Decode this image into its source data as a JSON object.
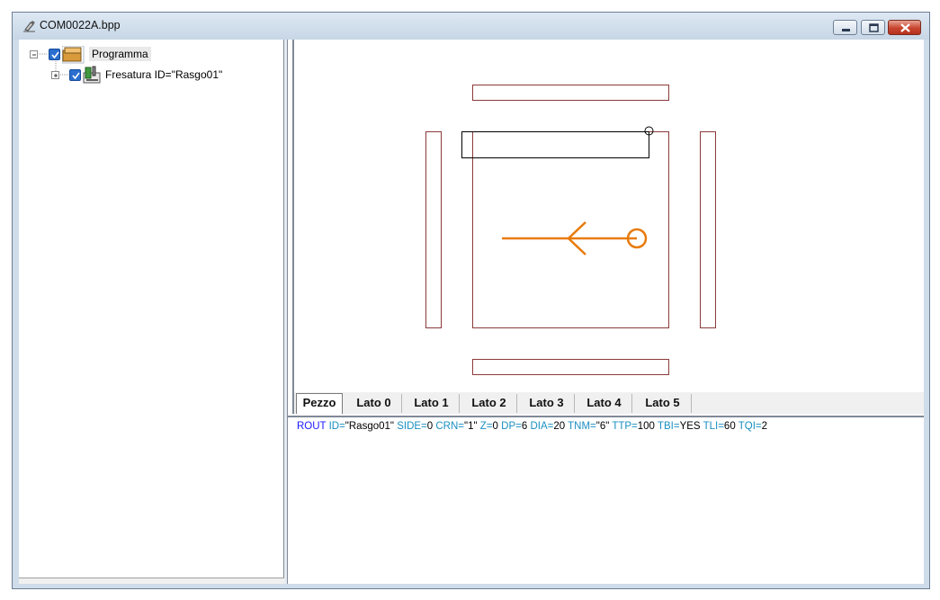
{
  "window": {
    "title": "COM0022A.bpp",
    "icon": "app-document-icon"
  },
  "tree": {
    "root": {
      "label": "Programma",
      "checked": true,
      "expanded": true
    },
    "child": {
      "label": "Fresatura ID=\"Rasgo01\"",
      "checked": true,
      "expanded": false
    }
  },
  "tabs": [
    "Pezzo",
    "Lato 0",
    "Lato 1",
    "Lato 2",
    "Lato 3",
    "Lato 4",
    "Lato 5"
  ],
  "active_tab": "Pezzo",
  "code": {
    "keyword": "ROUT",
    "parts": [
      {
        "k": "ID=",
        "v": "\"Rasgo01\""
      },
      {
        "k": "SIDE=",
        "v": "0"
      },
      {
        "k": "CRN=",
        "v": "\"1\""
      },
      {
        "k": "Z=",
        "v": "0"
      },
      {
        "k": "DP=",
        "v": "6"
      },
      {
        "k": "DIA=",
        "v": "20"
      },
      {
        "k": "TNM=",
        "v": "\"6\""
      },
      {
        "k": "TTP=",
        "v": "100"
      },
      {
        "k": "TBI=",
        "v": "YES"
      },
      {
        "k": "TLI=",
        "v": "60"
      },
      {
        "k": "TQI=",
        "v": "2"
      }
    ]
  },
  "colors": {
    "panel_outline": "#8b3a3a",
    "tool_path": "#e87b0c",
    "keyword": "#1a1aff",
    "param": "#1a8fc0"
  }
}
